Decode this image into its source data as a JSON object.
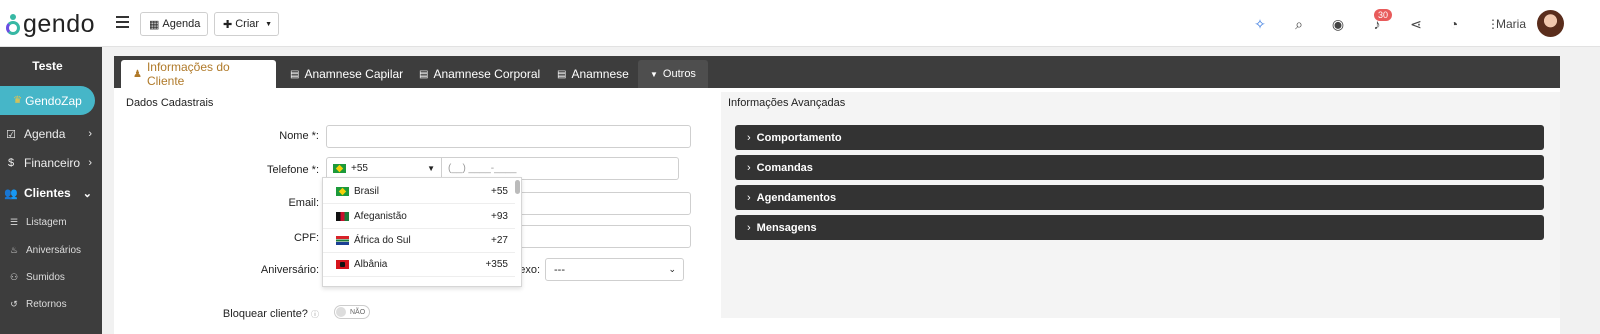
{
  "brand": {
    "logo_text": "gendo"
  },
  "toolbar": {
    "agenda_label": "Agenda",
    "criar_label": "Criar"
  },
  "header": {
    "notification_count": "30",
    "user_name": "Maria"
  },
  "sidebar": {
    "title": "Teste",
    "gendozap_label": "GendoZap",
    "items": [
      {
        "label": "Agenda",
        "icon": "calendar-check-icon"
      },
      {
        "label": "Financeiro",
        "icon": "dollar-icon"
      },
      {
        "label": "Clientes",
        "icon": "users-icon"
      }
    ],
    "subitems": [
      {
        "label": "Listagem",
        "icon": "list-icon"
      },
      {
        "label": "Aniversários",
        "icon": "birthday-cake-icon"
      },
      {
        "label": "Sumidos",
        "icon": "user-slash-icon"
      },
      {
        "label": "Retornos",
        "icon": "undo-icon"
      }
    ]
  },
  "tabs": [
    {
      "label": "Informações do Cliente",
      "icon": "user-icon",
      "active": true
    },
    {
      "label": "Anamnese Capilar",
      "icon": "document-icon"
    },
    {
      "label": "Anamnese Corporal",
      "icon": "document-icon"
    },
    {
      "label": "Anamnese",
      "icon": "document-icon"
    },
    {
      "label": "Outros",
      "icon": "caret-down-icon"
    }
  ],
  "form": {
    "section_title": "Dados Cadastrais",
    "nome_label": "Nome *:",
    "telefone_label": "Telefone *:",
    "email_label": "Email:",
    "cpf_label": "CPF:",
    "aniversario_label": "Aniversário:",
    "sexo_label": "exo:",
    "sexo_value": "---",
    "bloquear_label": "Bloquear cliente?",
    "toggle_text": "NÃO",
    "phone_country_code": "+55",
    "phone_placeholder": "(__) ____-____"
  },
  "country_dropdown": [
    {
      "name": "Brasil",
      "code": "+55",
      "flag": "br"
    },
    {
      "name": "Afeganistão",
      "code": "+93",
      "flag": "af"
    },
    {
      "name": "África do Sul",
      "code": "+27",
      "flag": "za"
    },
    {
      "name": "Albânia",
      "code": "+355",
      "flag": "al"
    }
  ],
  "advanced": {
    "section_title": "Informações Avançadas",
    "accordions": [
      "Comportamento",
      "Comandas",
      "Agendamentos",
      "Mensagens"
    ]
  },
  "colors": {
    "sidebar_bg": "#3d3d3d",
    "gendozap_bg": "#46b6c8",
    "active_tab_text": "#b07a2a",
    "badge_bg": "#e85b5b"
  }
}
